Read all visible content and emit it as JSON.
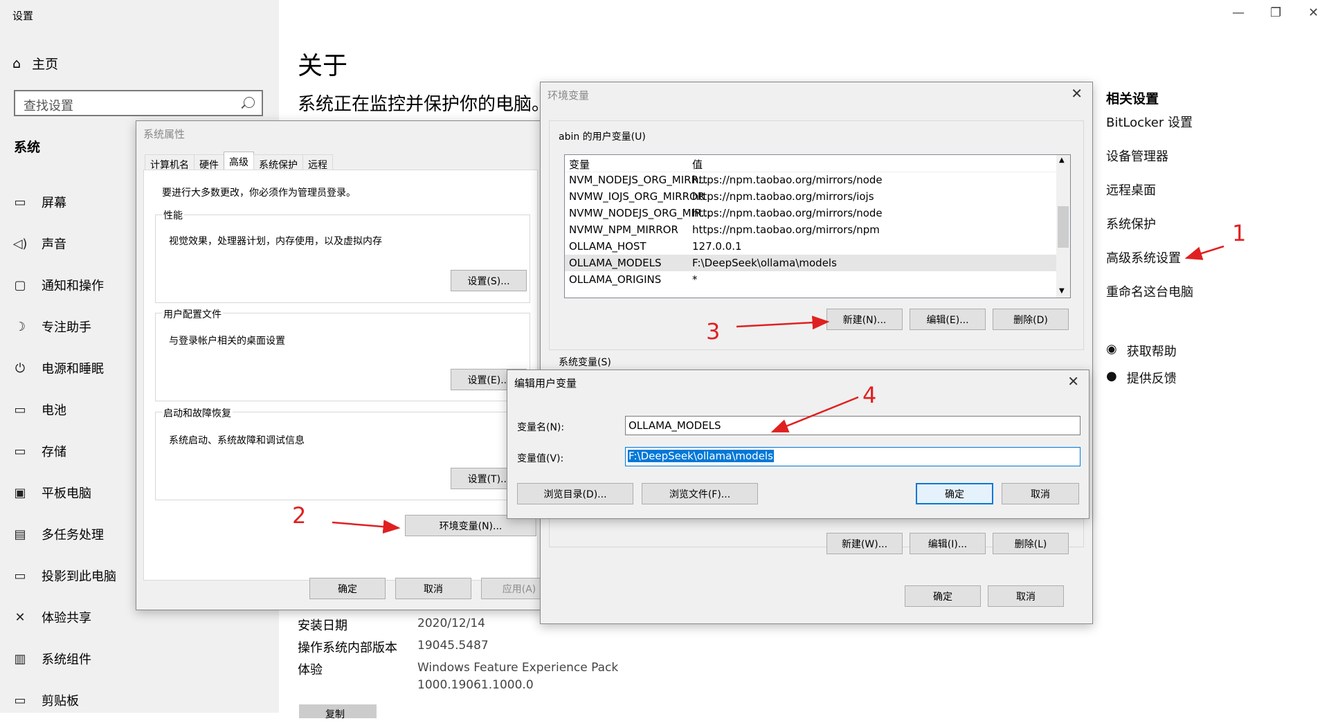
{
  "window": {
    "title": "设置",
    "minimize": "—",
    "restore": "❐",
    "close": "✕"
  },
  "sidebar": {
    "home": "主页",
    "search_placeholder": "查找设置",
    "section": "系统",
    "items": [
      {
        "icon": "monitor-icon",
        "glyph": "▭",
        "label": "屏幕"
      },
      {
        "icon": "speaker-icon",
        "glyph": "◁)",
        "label": "声音"
      },
      {
        "icon": "notification-icon",
        "glyph": "▢",
        "label": "通知和操作"
      },
      {
        "icon": "moon-icon",
        "glyph": "☽",
        "label": "专注助手"
      },
      {
        "icon": "power-icon",
        "glyph": "⏻",
        "label": "电源和睡眠"
      },
      {
        "icon": "battery-icon",
        "glyph": "▭",
        "label": "电池"
      },
      {
        "icon": "storage-icon",
        "glyph": "▭",
        "label": "存储"
      },
      {
        "icon": "tablet-icon",
        "glyph": "▣",
        "label": "平板电脑"
      },
      {
        "icon": "multitask-icon",
        "glyph": "▤",
        "label": "多任务处理"
      },
      {
        "icon": "project-icon",
        "glyph": "▭",
        "label": "投影到此电脑"
      },
      {
        "icon": "share-icon",
        "glyph": "✕",
        "label": "体验共享"
      },
      {
        "icon": "components-icon",
        "glyph": "▥",
        "label": "系统组件"
      },
      {
        "icon": "clipboard-icon",
        "glyph": "▭",
        "label": "剪贴板"
      }
    ]
  },
  "main": {
    "title": "关于",
    "subtitle": "系统正在监控并保护你的电脑。",
    "specs": [
      {
        "label": "安装日期",
        "value": "2020/12/14"
      },
      {
        "label": "操作系统内部版本",
        "value": "19045.5487"
      },
      {
        "label": "体验",
        "value": "Windows Feature Experience Pack"
      }
    ],
    "specs_extra": "1000.19061.1000.0",
    "copy_label": "复制"
  },
  "related": {
    "heading": "相关设置",
    "links": [
      "BitLocker 设置",
      "设备管理器",
      "远程桌面",
      "系统保护",
      "高级系统设置",
      "重命名这台电脑"
    ],
    "help": "获取帮助",
    "feedback": "提供反馈"
  },
  "sysprop": {
    "title": "系统属性",
    "tabs": [
      "计算机名",
      "硬件",
      "高级",
      "系统保护",
      "远程"
    ],
    "admin_note": "要进行大多数更改，你必须作为管理员登录。",
    "perf_label": "性能",
    "perf_desc": "视觉效果，处理器计划，内存使用，以及虚拟内存",
    "perf_btn": "设置(S)...",
    "profile_label": "用户配置文件",
    "profile_desc": "与登录帐户相关的桌面设置",
    "profile_btn": "设置(E)...",
    "startup_label": "启动和故障恢复",
    "startup_desc": "系统启动、系统故障和调试信息",
    "startup_btn": "设置(T)...",
    "env_btn": "环境变量(N)...",
    "ok": "确定",
    "cancel": "取消",
    "apply": "应用(A)"
  },
  "envdlg": {
    "title": "环境变量",
    "user_group": "abin 的用户变量(U)",
    "col_var": "变量",
    "col_val": "值",
    "rows": [
      {
        "var": "NVM_NODEJS_ORG_MIRR...",
        "val": "https://npm.taobao.org/mirrors/node"
      },
      {
        "var": "NVMW_IOJS_ORG_MIRROR",
        "val": "https://npm.taobao.org/mirrors/iojs"
      },
      {
        "var": "NVMW_NODEJS_ORG_MIR...",
        "val": "https://npm.taobao.org/mirrors/node"
      },
      {
        "var": "NVMW_NPM_MIRROR",
        "val": "https://npm.taobao.org/mirrors/npm"
      },
      {
        "var": "OLLAMA_HOST",
        "val": "127.0.0.1"
      },
      {
        "var": "OLLAMA_MODELS",
        "val": "F:\\DeepSeek\\ollama\\models"
      },
      {
        "var": "OLLAMA_ORIGINS",
        "val": "*"
      }
    ],
    "new_u": "新建(N)...",
    "edit_u": "编辑(E)...",
    "del_u": "删除(D)",
    "sys_group": "系统变量(S)",
    "new_s": "新建(W)...",
    "edit_s": "编辑(I)...",
    "del_s": "删除(L)",
    "ok": "确定",
    "cancel": "取消"
  },
  "editdlg": {
    "title": "编辑用户变量",
    "name_label": "变量名(N):",
    "value_label": "变量值(V):",
    "name_value": "OLLAMA_MODELS",
    "value_value": "F:\\DeepSeek\\ollama\\models",
    "browse_dir": "浏览目录(D)...",
    "browse_file": "浏览文件(F)...",
    "ok": "确定",
    "cancel": "取消"
  },
  "annotations": [
    "1",
    "2",
    "3",
    "4"
  ],
  "colors": {
    "accent": "#0078d7",
    "annotation": "#e02020",
    "sidebar_bg": "#f0f0f0"
  }
}
